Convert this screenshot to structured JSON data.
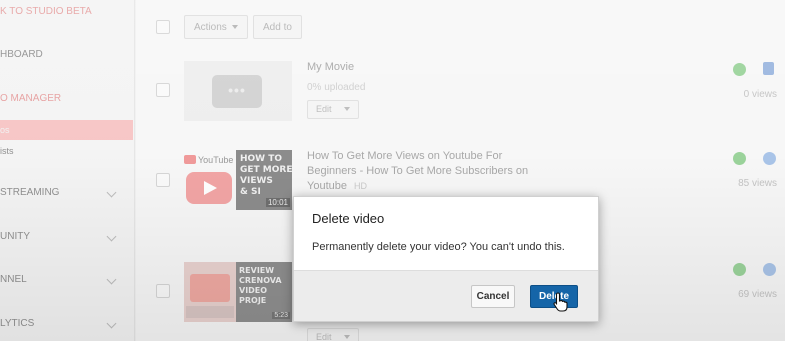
{
  "sidebar": {
    "back_link": "K TO STUDIO BETA",
    "dashboard": "HBOARD",
    "video_manager": "O MANAGER",
    "videos": "os",
    "playlists": "ists",
    "live_streaming": " STREAMING",
    "community": "UNITY",
    "channel": "NNEL",
    "analytics": "LYTICS"
  },
  "toolbar": {
    "actions_label": "Actions",
    "add_to_label": "Add to"
  },
  "videos": [
    {
      "title": "My Movie",
      "status": "0% uploaded",
      "edit_label": "Edit",
      "views": "0 views"
    },
    {
      "title": "How To Get More Views on Youtube For Beginners - How To Get More Subscribers on Youtube",
      "hd": "HD",
      "views": "85 views",
      "thumb_brand": "YouTube",
      "thumb_text": "HOW TO\nGET MORE\nVIEWS\n& SI",
      "thumb_duration": "10:01"
    },
    {
      "views": "69 views",
      "edit_label": "Edit",
      "thumb_text": "REVIEW\nCRENOVA\nVIDEO\nPROJE",
      "thumb_duration": "5:23"
    }
  ],
  "dialog": {
    "title": "Delete video",
    "message": "Permanently delete your video? You can't undo this.",
    "cancel_label": "Cancel",
    "delete_label": "Delete"
  },
  "colors": {
    "delete_button": "#1565a8",
    "monetization_icon": "#9bd39b",
    "public_icon": "#a9c4e8",
    "private_icon": "#9bb6df",
    "sidebar_active": "#f7c6c6"
  },
  "icons": {
    "monetization": "dollar-circle-icon",
    "privacy_private": "lock-icon",
    "privacy_public": "globe-icon"
  }
}
